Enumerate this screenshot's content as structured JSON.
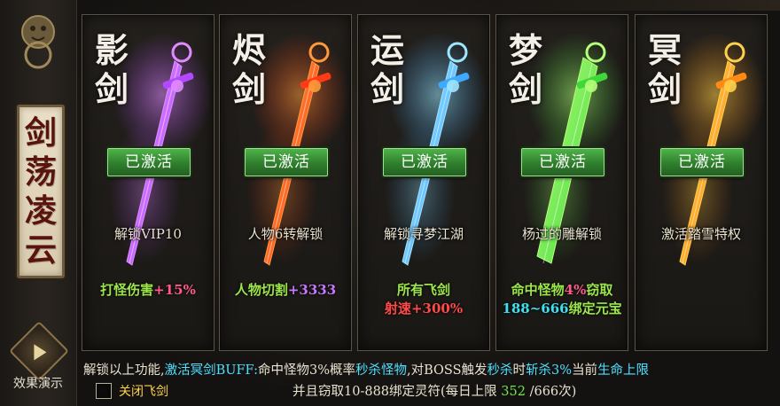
{
  "sidebar": {
    "banner_chars": [
      "剑",
      "荡",
      "凌",
      "云"
    ],
    "demo_label": "效果演示"
  },
  "cards": [
    {
      "name": [
        "影",
        "剑"
      ],
      "badge": "已激活",
      "unlock": "解锁VIP10",
      "bonus_line1": [
        {
          "text": "打怪伤害",
          "color": "green"
        },
        {
          "text": "+15%",
          "color": "pink"
        }
      ],
      "bonus_line2": [],
      "sword_color": "#b248ff",
      "glow_color": "#e08cff"
    },
    {
      "name": [
        "烬",
        "剑"
      ],
      "badge": "已激活",
      "unlock": "人物6转解锁",
      "bonus_line1": [
        {
          "text": "人物切割",
          "color": "green"
        },
        {
          "text": "+3333",
          "color": "purple"
        }
      ],
      "bonus_line2": [],
      "sword_color": "#ff3a16",
      "glow_color": "#ff9a3a"
    },
    {
      "name": [
        "运",
        "剑"
      ],
      "badge": "已激活",
      "unlock": "解锁寻梦江湖",
      "bonus_line1": [
        {
          "text": "所有飞剑",
          "color": "green"
        }
      ],
      "bonus_line2": [
        {
          "text": "射速",
          "color": "red"
        },
        {
          "text": "+300%",
          "color": "red"
        }
      ],
      "sword_color": "#3fa8ff",
      "glow_color": "#9fe6ff"
    },
    {
      "name": [
        "梦",
        "剑"
      ],
      "badge": "已激活",
      "unlock": "杨过的雕解锁",
      "bonus_line1": [
        {
          "text": "命中怪物",
          "color": "green"
        },
        {
          "text": "4%",
          "color": "pink"
        },
        {
          "text": "窃取",
          "color": "green"
        }
      ],
      "bonus_line2": [
        {
          "text": "188~666",
          "color": "cyan"
        },
        {
          "text": "绑定元宝",
          "color": "green"
        }
      ],
      "sword_color": "#3fd83a",
      "glow_color": "#b6ff7a"
    },
    {
      "name": [
        "冥",
        "剑"
      ],
      "badge": "已激活",
      "unlock": "激活踏雪特权",
      "bonus_line1": [],
      "bonus_line2": [],
      "sword_color": "#ff8a14",
      "glow_color": "#ffd04a"
    }
  ],
  "footer": {
    "line1": [
      {
        "text": "解锁以上功能,",
        "cls": ""
      },
      {
        "text": "激活冥剑BUFF:",
        "cls": "hl-cyan"
      },
      {
        "text": "命中怪物3%概率",
        "cls": ""
      },
      {
        "text": "秒杀怪物",
        "cls": "hl-cyan"
      },
      {
        "text": ",对BOSS触发",
        "cls": ""
      },
      {
        "text": "秒杀",
        "cls": "hl-cyan"
      },
      {
        "text": "时",
        "cls": ""
      },
      {
        "text": "斩杀3%",
        "cls": "hl-cyan"
      },
      {
        "text": "当前",
        "cls": ""
      },
      {
        "text": "生命上限",
        "cls": "hl-cyan"
      }
    ],
    "line2": [
      {
        "text": "并且窃取10-888绑定灵符(每日上限 ",
        "cls": ""
      },
      {
        "text": "352",
        "cls": "hl-green"
      },
      {
        "text": " /666次)",
        "cls": ""
      }
    ],
    "checkbox_label": "关闭飞剑"
  },
  "colors": {
    "badge_green": "#2f7f2d",
    "bonus_green": "#9be74a",
    "highlight_cyan": "#4fe0ff",
    "checkbox_label": "#ffd34a"
  }
}
